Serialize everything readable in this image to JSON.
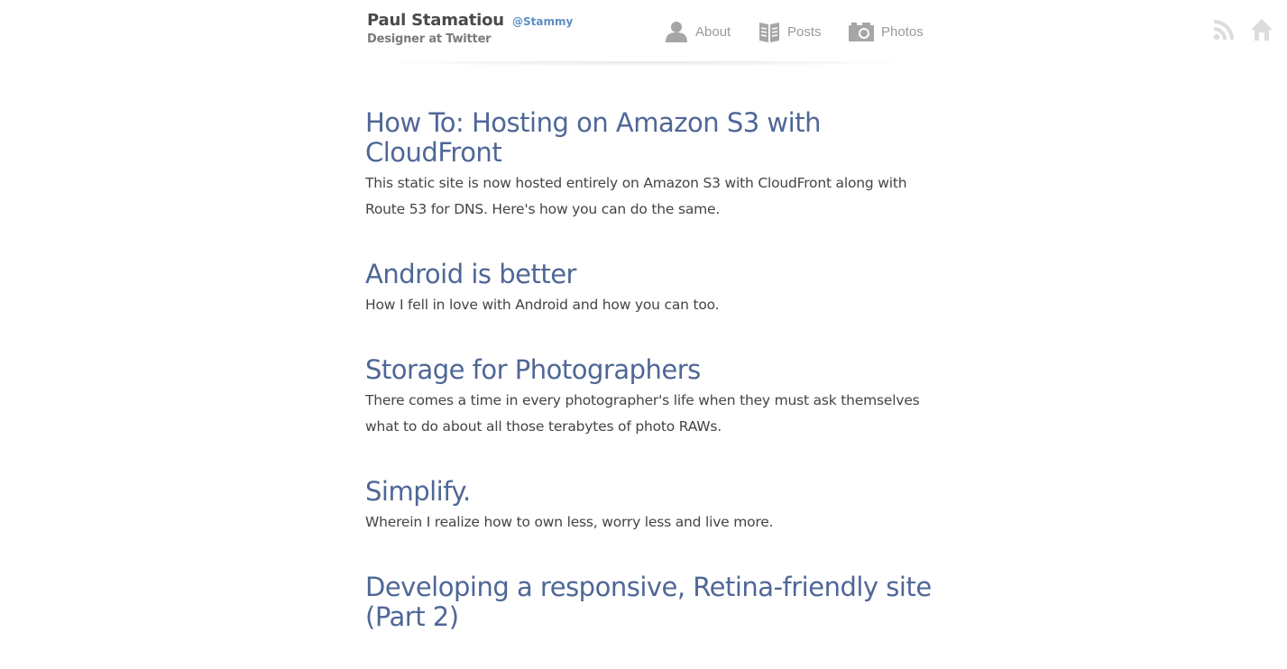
{
  "header": {
    "name": "Paul Stamatiou",
    "handle": "@Stammy",
    "tagline": "Designer at Twitter",
    "nav": {
      "about": "About",
      "posts": "Posts",
      "photos": "Photos"
    },
    "icons": {
      "about": "user-icon",
      "posts": "book-icon",
      "photos": "camera-icon",
      "rss": "rss-icon",
      "home": "home-icon"
    }
  },
  "colors": {
    "title": "#4f6797",
    "handle": "#5d8fc4",
    "nav": "#9a9a9a"
  },
  "posts": [
    {
      "title": "How To: Hosting on Amazon S3 with CloudFront",
      "description": "This static site is now hosted entirely on Amazon S3 with CloudFront along with Route 53 for DNS. Here's how you can do the same."
    },
    {
      "title": "Android is better",
      "description": "How I fell in love with Android and how you can too."
    },
    {
      "title": "Storage for Photographers",
      "description": "There comes a time in every photographer's life when they must ask themselves what to do about all those terabytes of photo RAWs."
    },
    {
      "title": "Simplify.",
      "description": "Wherein I realize how to own less, worry less and live more."
    },
    {
      "title": "Developing a responsive, Retina-friendly site (Part 2)",
      "description": ""
    }
  ]
}
